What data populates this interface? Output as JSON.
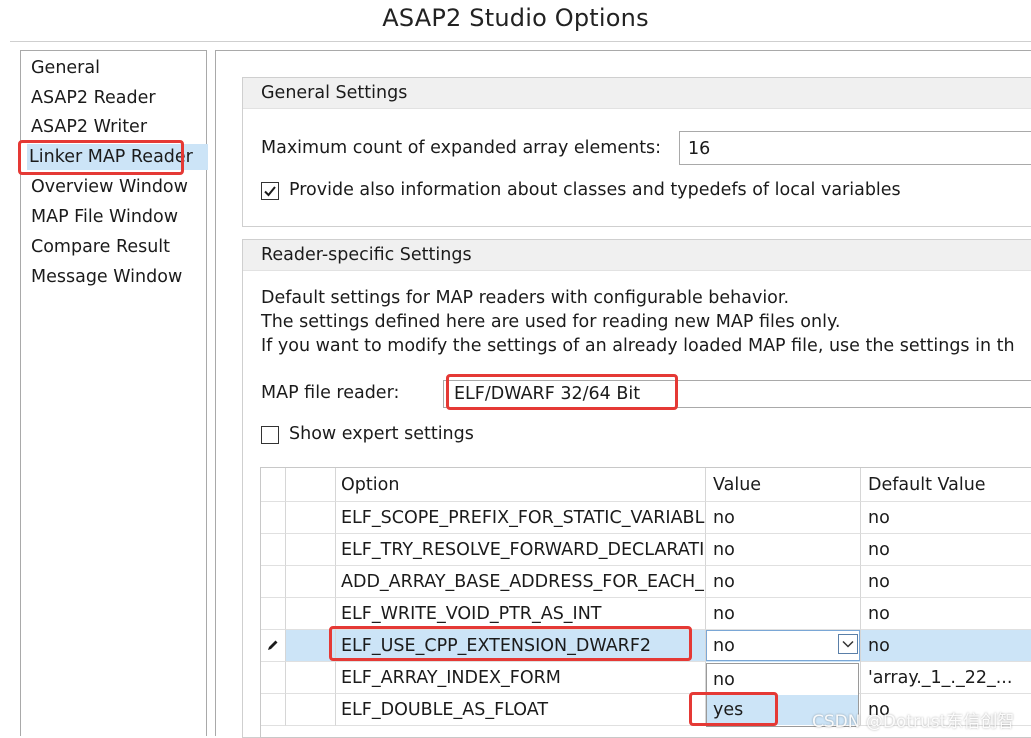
{
  "window": {
    "title": "ASAP2 Studio Options"
  },
  "nav": {
    "items": [
      {
        "label": "General"
      },
      {
        "label": "ASAP2 Reader"
      },
      {
        "label": "ASAP2 Writer"
      },
      {
        "label": "Linker MAP Reader",
        "selected": true
      },
      {
        "label": "Overview Window"
      },
      {
        "label": "MAP File Window"
      },
      {
        "label": "Compare Result"
      },
      {
        "label": "Message Window"
      }
    ]
  },
  "general": {
    "header": "General Settings",
    "max_count_label": "Maximum count of expanded array elements:",
    "max_count_value": "16",
    "provide_info_label": "Provide also information about classes and typedefs of local variables",
    "provide_info_checked": true
  },
  "reader": {
    "header": "Reader-specific Settings",
    "desc_line1": "Default settings for MAP readers with configurable behavior.",
    "desc_line2": "The settings defined here are used for reading new MAP files only.",
    "desc_line3": "If you want to modify the settings of an already loaded MAP file, use the settings in th",
    "map_reader_label": "MAP file reader:",
    "map_reader_value": "ELF/DWARF 32/64 Bit",
    "show_expert_label": "Show expert settings",
    "show_expert_checked": false
  },
  "grid": {
    "columns": {
      "option": "Option",
      "value": "Value",
      "default": "Default Value"
    },
    "rows": [
      {
        "option": "ELF_SCOPE_PREFIX_FOR_STATIC_VARIABLES",
        "value": "no",
        "default": "no"
      },
      {
        "option": "ELF_TRY_RESOLVE_FORWARD_DECLARATIONS",
        "value": "no",
        "default": "no"
      },
      {
        "option": "ADD_ARRAY_BASE_ADDRESS_FOR_EACH_ELEMENT",
        "value": "no",
        "default": "no"
      },
      {
        "option": "ELF_WRITE_VOID_PTR_AS_INT",
        "value": "no",
        "default": "no"
      },
      {
        "option": "ELF_USE_CPP_EXTENSION_DWARF2",
        "value": "no",
        "default": "no",
        "selected": true
      },
      {
        "option": "ELF_ARRAY_INDEX_FORM",
        "value": "",
        "default": "'array._1_._22_..."
      },
      {
        "option": "ELF_DOUBLE_AS_FLOAT",
        "value": "",
        "default": "no"
      }
    ],
    "dropdown_options": [
      "no",
      "yes"
    ],
    "dropdown_highlighted": "yes"
  },
  "watermark": "CSDN @Dotrust东信创智",
  "colors": {
    "selection": "#cce4f7",
    "highlight_box": "#e53935",
    "header_bg": "#f0f0f0"
  }
}
